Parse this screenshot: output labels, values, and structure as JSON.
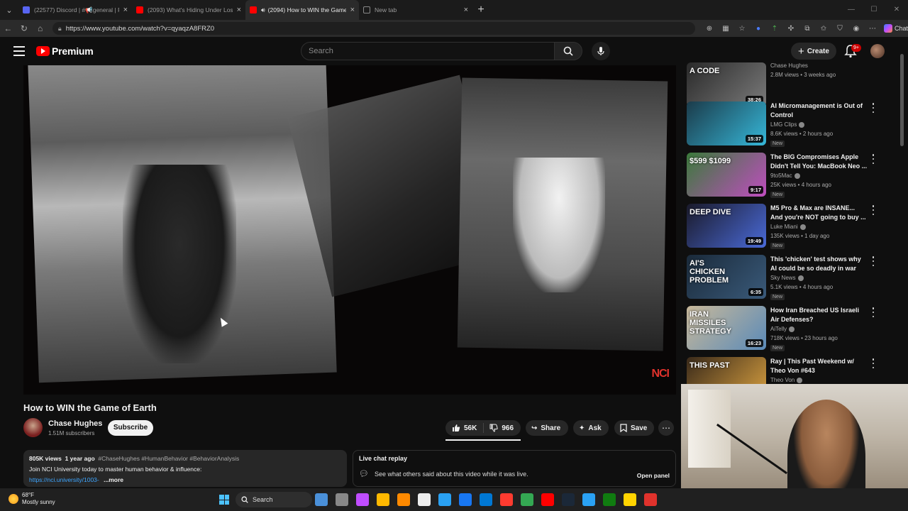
{
  "browser": {
    "tabs": [
      {
        "title": "(22577) Discord | #📢general | Pu",
        "active": false,
        "color": "#5865f2"
      },
      {
        "title": "(2093) What's Hiding Under Los A",
        "active": false,
        "color": "#ff0000"
      },
      {
        "title": "(2094) How to WIN the Game",
        "active": true,
        "color": "#ff0000"
      },
      {
        "title": "New tab",
        "active": false,
        "color": "#888888"
      }
    ],
    "url": "https://www.youtube.com/watch?v=qyaqzA8FRZ0",
    "copilot_label": "Chat"
  },
  "header": {
    "logo_text": "Premium",
    "search_placeholder": "Search",
    "create_label": "Create",
    "notif_badge": "9+"
  },
  "video": {
    "watermark": "NCI",
    "title": "How to WIN the Game of Earth",
    "channel": "Chase Hughes",
    "subscribers": "1.51M subscribers",
    "subscribe_label": "Subscribe",
    "likes": "56K",
    "dislikes": "966",
    "share_label": "Share",
    "ask_label": "Ask",
    "save_label": "Save"
  },
  "description": {
    "views": "805K views",
    "age": "1 year ago",
    "tags": "#ChaseHughes #HumanBehavior #BehaviorAnalysis",
    "line1": "Join NCI University today to master human behavior & influence:",
    "link": "https://nci.university/1003-",
    "more": "...more"
  },
  "chat": {
    "title": "Live chat replay",
    "subtitle": "See what others said about this video while it was live.",
    "open_label": "Open panel"
  },
  "sidebar": [
    {
      "thumb_text": "A CODE",
      "duration": "38:26",
      "title": "",
      "channel": "Chase Hughes",
      "verified": false,
      "views": "2.8M views • 3 weeks ago",
      "new": false,
      "colors": [
        "#2a2a2a",
        "#7a7a7a"
      ]
    },
    {
      "thumb_text": "",
      "duration": "15:37",
      "title": "AI Micromanagement is Out of Control",
      "channel": "LMG Clips",
      "verified": true,
      "views": "8.6K views • 2 hours ago",
      "new": true,
      "colors": [
        "#1b3b4a",
        "#36b7d8"
      ]
    },
    {
      "thumb_text": "$599 $1099",
      "duration": "9:17",
      "title": "The BIG Compromises Apple Didn't Tell You: MacBook Neo ...",
      "channel": "9to5Mac",
      "verified": true,
      "views": "25K views • 4 hours ago",
      "new": true,
      "colors": [
        "#3a7a3a",
        "#c04dc0"
      ]
    },
    {
      "thumb_text": "DEEP DIVE",
      "duration": "19:49",
      "title": "M5 Pro & Max are INSANE... And you're NOT going to buy ...",
      "channel": "Luke Miani",
      "verified": true,
      "views": "135K views • 1 day ago",
      "new": true,
      "colors": [
        "#1a1a2a",
        "#4a6ad8"
      ]
    },
    {
      "thumb_text": "AI'S CHICKEN PROBLEM",
      "duration": "6:35",
      "title": "This 'chicken' test shows why AI could be so deadly in war",
      "channel": "Sky News",
      "verified": true,
      "views": "5.1K views • 4 hours ago",
      "new": true,
      "colors": [
        "#1a2a3a",
        "#3a5a7a"
      ]
    },
    {
      "thumb_text": "IRAN MISSILES STRATEGY",
      "duration": "16:23",
      "title": "How Iran Breached US Israeli Air Defenses?",
      "channel": "AiTelly",
      "verified": true,
      "views": "718K views • 23 hours ago",
      "new": true,
      "colors": [
        "#c9b99a",
        "#5a8ab8"
      ]
    },
    {
      "thumb_text": "THIS PAST",
      "duration": "",
      "title": "Ray | This Past Weekend w/ Theo Von #643",
      "channel": "Theo Von",
      "verified": true,
      "views": "",
      "new": false,
      "colors": [
        "#3a2a1a",
        "#d8a040"
      ]
    }
  ],
  "taskbar": {
    "temp": "68°F",
    "weather": "Mostly sunny",
    "search_label": "Search",
    "app_colors": [
      "#4a90d9",
      "#888888",
      "#c04dff",
      "#ffb900",
      "#ff8a00",
      "#eeeeee",
      "#2aa1f3",
      "#1877f2",
      "#0078d4",
      "#ff3b30",
      "#34a853",
      "#ff0000",
      "#1b2838",
      "#2aa1f3",
      "#107c10",
      "#ffd400",
      "#e0322c"
    ]
  }
}
